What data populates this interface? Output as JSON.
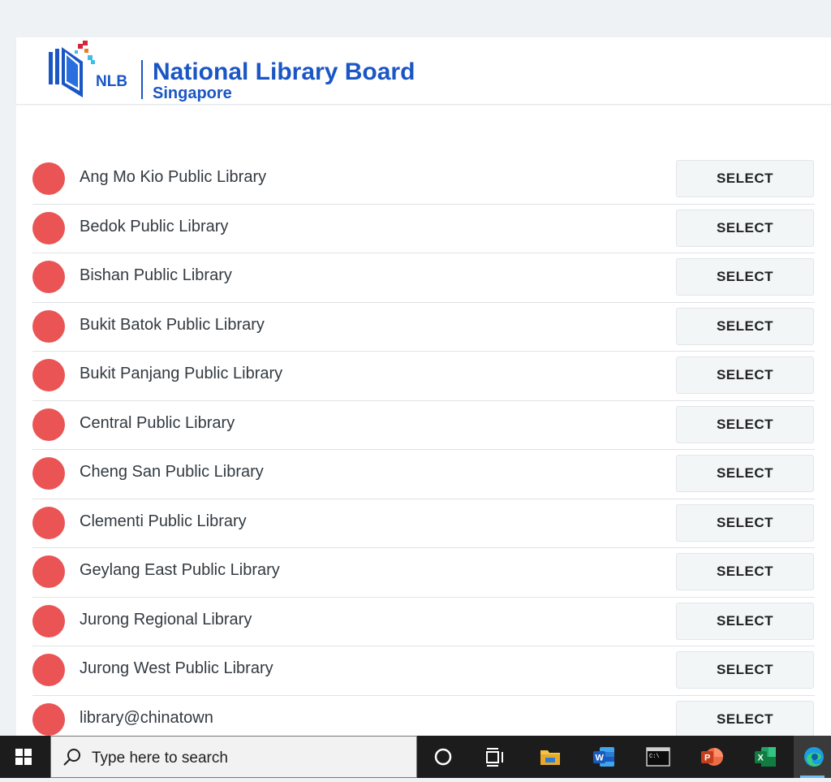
{
  "header": {
    "logo_abbr": "NLB",
    "logo_title": "National Library Board",
    "logo_subtitle": "Singapore"
  },
  "libraries": [
    {
      "name": "Ang Mo Kio Public Library",
      "button": "SELECT"
    },
    {
      "name": "Bedok Public Library",
      "button": "SELECT"
    },
    {
      "name": "Bishan Public Library",
      "button": "SELECT"
    },
    {
      "name": "Bukit Batok Public Library",
      "button": "SELECT"
    },
    {
      "name": "Bukit Panjang Public Library",
      "button": "SELECT"
    },
    {
      "name": "Central Public Library",
      "button": "SELECT"
    },
    {
      "name": "Cheng San Public Library",
      "button": "SELECT"
    },
    {
      "name": "Clementi Public Library",
      "button": "SELECT"
    },
    {
      "name": "Geylang East Public Library",
      "button": "SELECT"
    },
    {
      "name": "Jurong Regional Library",
      "button": "SELECT"
    },
    {
      "name": "Jurong West Public Library",
      "button": "SELECT"
    },
    {
      "name": "library@chinatown",
      "button": "SELECT"
    }
  ],
  "status_color": "#ea5455",
  "taskbar": {
    "search_placeholder": "Type here to search",
    "icons": [
      "windows-start-icon",
      "search-icon",
      "cortana-icon",
      "task-view-icon",
      "file-explorer-icon",
      "word-icon",
      "terminal-icon",
      "powerpoint-icon",
      "excel-icon",
      "edge-icon"
    ]
  }
}
